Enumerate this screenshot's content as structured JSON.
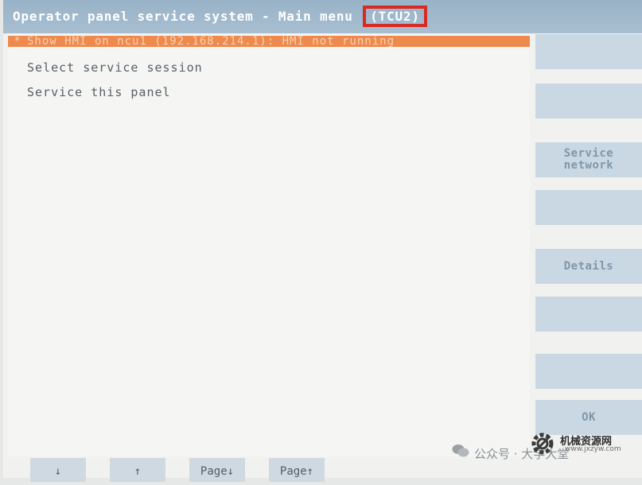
{
  "window": {
    "title": "Operator panel service system - Main menu",
    "title_tag": "(TCU2)",
    "tag_highlight_color": "#d62a22",
    "title_bar_color": "#a8bfd1"
  },
  "menu": {
    "items": [
      {
        "marker": "*",
        "label": "Show HMI on ncu1 (192.168.214.1): HMI not running",
        "selected": true
      },
      {
        "label": "Select service session"
      },
      {
        "label": "Service this panel"
      }
    ],
    "selection_color": "#ee8a4e"
  },
  "softkeys": [
    {
      "label": ""
    },
    {
      "label": ""
    },
    {
      "label": "Service\nnetwork"
    },
    {
      "label": ""
    },
    {
      "label": "Details"
    },
    {
      "label": ""
    },
    {
      "label": ""
    },
    {
      "label": "OK"
    }
  ],
  "bottom_keys": [
    {
      "label": "↓"
    },
    {
      "label": "↑"
    },
    {
      "label": "Page↓"
    },
    {
      "label": "Page↑"
    }
  ],
  "watermark": {
    "account_text": "公众号 · 大学大堂",
    "brand": "机械资源网",
    "url": "www.jxzyw.com"
  }
}
